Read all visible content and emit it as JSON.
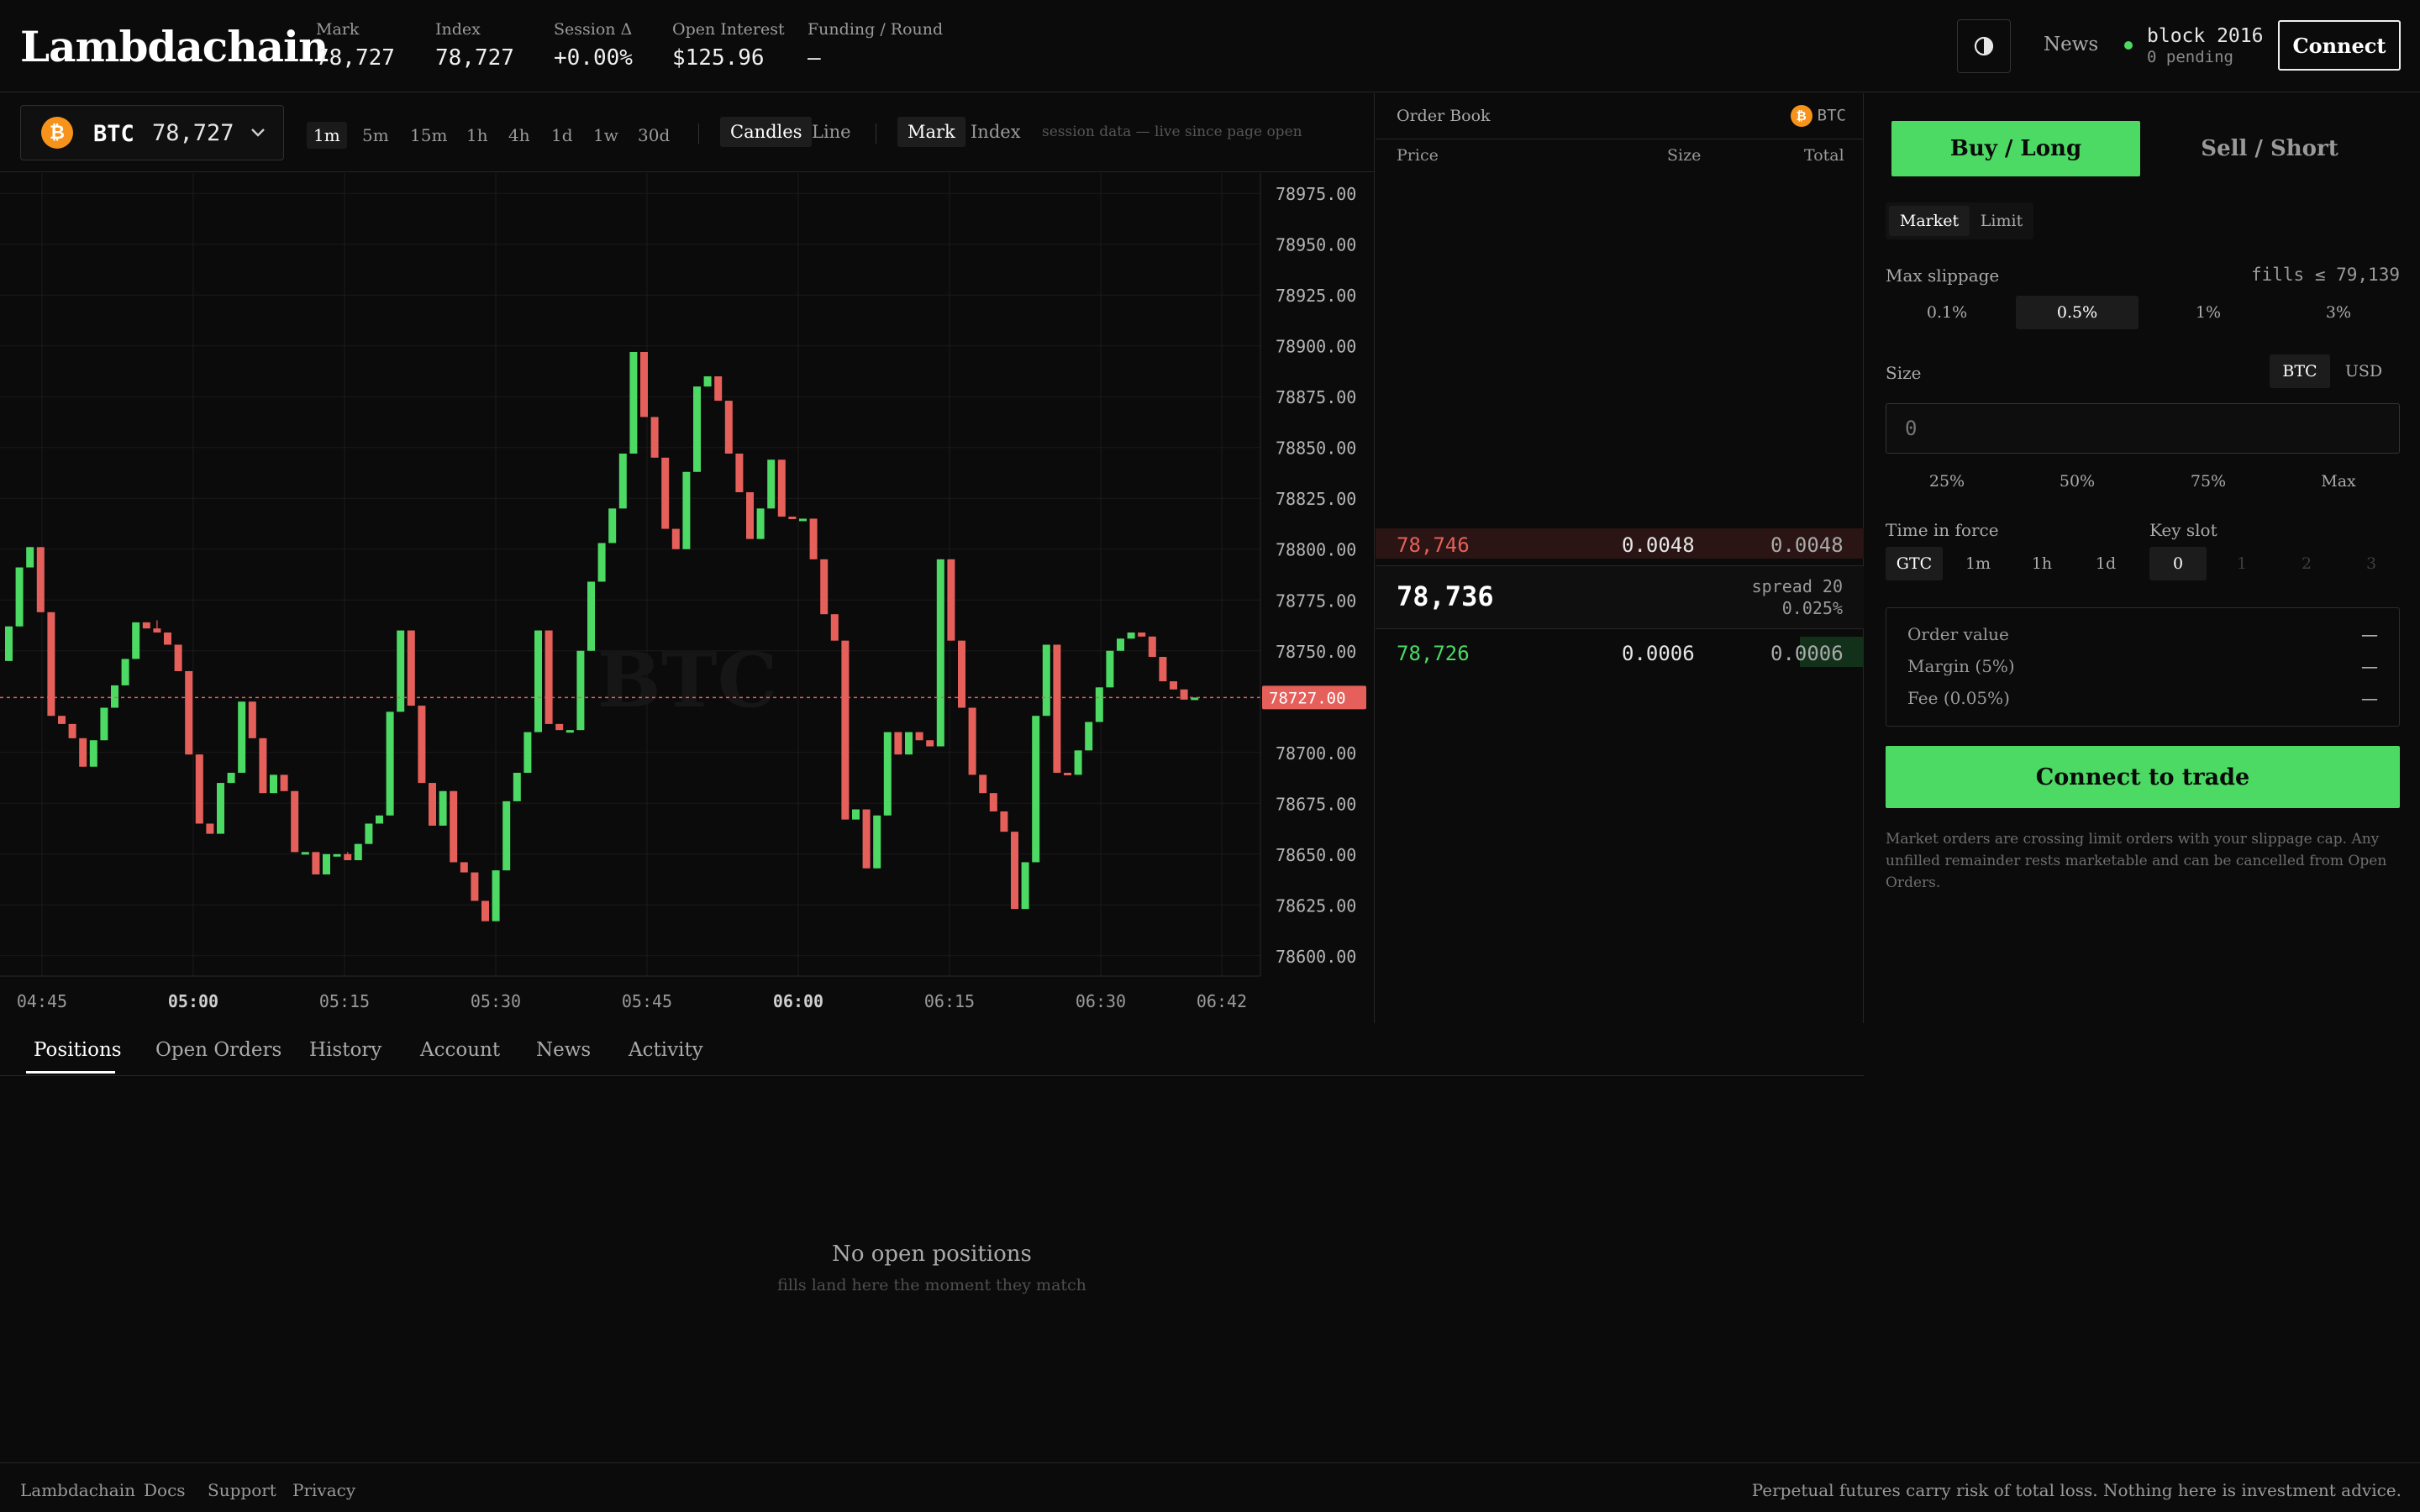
{
  "header": {
    "logo": "Lambdachain",
    "stats": [
      {
        "label": "Mark",
        "value": "78,727"
      },
      {
        "label": "Index",
        "value": "78,727"
      },
      {
        "label": "Session Δ",
        "value": "+0.00%"
      },
      {
        "label": "Open Interest",
        "value": "$125.96"
      },
      {
        "label": "Funding / Round",
        "value": "—"
      }
    ],
    "news_label": "News",
    "block_label": "block 2016",
    "pending_label": "0 pending",
    "connect_label": "Connect"
  },
  "toolbar": {
    "asset_symbol": "BTC",
    "asset_price": "78,727",
    "coin_glyph": "₿",
    "timeframes": [
      "1m",
      "5m",
      "15m",
      "1h",
      "4h",
      "1d",
      "1w",
      "30d"
    ],
    "active_timeframe": "1m",
    "chart_types": [
      "Candles",
      "Line"
    ],
    "active_chart_type": "Candles",
    "price_sources": [
      "Mark",
      "Index"
    ],
    "active_price_source": "Mark",
    "session_note": "session data — live since page open"
  },
  "chart_data": {
    "type": "candlestick",
    "watermark": "BTC",
    "ylim": [
      78590,
      78985
    ],
    "y_ticks": [
      "78975.00",
      "78950.00",
      "78925.00",
      "78900.00",
      "78875.00",
      "78850.00",
      "78825.00",
      "78800.00",
      "78775.00",
      "78750.00",
      "78700.00",
      "78675.00",
      "78650.00",
      "78625.00",
      "78600.00"
    ],
    "x_ticks": [
      "04:45",
      "05:00",
      "05:15",
      "05:30",
      "05:45",
      "06:00",
      "06:15",
      "06:30",
      "06:42"
    ],
    "current_price": 78727,
    "current_price_label": "78727.00",
    "candles": [
      [
        78745,
        78762,
        78745,
        78762
      ],
      [
        78762,
        78791,
        78762,
        78791
      ],
      [
        78791,
        78801,
        78791,
        78801
      ],
      [
        78801,
        78801,
        78769,
        78769
      ],
      [
        78769,
        78769,
        78718,
        78718
      ],
      [
        78718,
        78718,
        78714,
        78714
      ],
      [
        78714,
        78714,
        78707,
        78707
      ],
      [
        78707,
        78707,
        78693,
        78693
      ],
      [
        78693,
        78706,
        78693,
        78706
      ],
      [
        78706,
        78722,
        78706,
        78722
      ],
      [
        78722,
        78733,
        78722,
        78733
      ],
      [
        78733,
        78746,
        78733,
        78746
      ],
      [
        78746,
        78764,
        78746,
        78764
      ],
      [
        78764,
        78764,
        78761,
        78761
      ],
      [
        78761,
        78765,
        78759,
        78759
      ],
      [
        78759,
        78759,
        78753,
        78753
      ],
      [
        78753,
        78753,
        78740,
        78740
      ],
      [
        78740,
        78740,
        78699,
        78699
      ],
      [
        78699,
        78699,
        78665,
        78665
      ],
      [
        78665,
        78665,
        78660,
        78660
      ],
      [
        78660,
        78685,
        78660,
        78685
      ],
      [
        78685,
        78690,
        78685,
        78690
      ],
      [
        78690,
        78725,
        78690,
        78725
      ],
      [
        78725,
        78725,
        78707,
        78707
      ],
      [
        78707,
        78707,
        78680,
        78680
      ],
      [
        78680,
        78689,
        78680,
        78689
      ],
      [
        78689,
        78689,
        78681,
        78681
      ],
      [
        78681,
        78681,
        78651,
        78651
      ],
      [
        78651,
        78651,
        78651,
        78651
      ],
      [
        78651,
        78651,
        78640,
        78640
      ],
      [
        78640,
        78650,
        78640,
        78650
      ],
      [
        78650,
        78650,
        78650,
        78650
      ],
      [
        78650,
        78651,
        78647,
        78647
      ],
      [
        78647,
        78655,
        78647,
        78655
      ],
      [
        78655,
        78665,
        78655,
        78665
      ],
      [
        78665,
        78669,
        78665,
        78669
      ],
      [
        78669,
        78720,
        78669,
        78720
      ],
      [
        78720,
        78760,
        78720,
        78760
      ],
      [
        78760,
        78760,
        78723,
        78723
      ],
      [
        78723,
        78723,
        78685,
        78685
      ],
      [
        78685,
        78685,
        78664,
        78664
      ],
      [
        78664,
        78681,
        78664,
        78681
      ],
      [
        78681,
        78681,
        78646,
        78646
      ],
      [
        78646,
        78646,
        78641,
        78641
      ],
      [
        78641,
        78641,
        78627,
        78627
      ],
      [
        78627,
        78627,
        78617,
        78617
      ],
      [
        78617,
        78642,
        78617,
        78642
      ],
      [
        78642,
        78676,
        78642,
        78676
      ],
      [
        78676,
        78690,
        78676,
        78690
      ],
      [
        78690,
        78710,
        78690,
        78710
      ],
      [
        78710,
        78760,
        78710,
        78760
      ],
      [
        78760,
        78760,
        78714,
        78714
      ],
      [
        78714,
        78714,
        78711,
        78711
      ],
      [
        78711,
        78711,
        78711,
        78711
      ],
      [
        78711,
        78750,
        78711,
        78750
      ],
      [
        78750,
        78784,
        78750,
        78784
      ],
      [
        78784,
        78803,
        78784,
        78803
      ],
      [
        78803,
        78820,
        78803,
        78820
      ],
      [
        78820,
        78847,
        78820,
        78847
      ],
      [
        78847,
        78897,
        78847,
        78897
      ],
      [
        78897,
        78897,
        78865,
        78865
      ],
      [
        78865,
        78865,
        78845,
        78845
      ],
      [
        78845,
        78845,
        78810,
        78810
      ],
      [
        78810,
        78810,
        78800,
        78800
      ],
      [
        78800,
        78838,
        78800,
        78838
      ],
      [
        78838,
        78880,
        78838,
        78880
      ],
      [
        78880,
        78885,
        78880,
        78885
      ],
      [
        78885,
        78885,
        78873,
        78873
      ],
      [
        78873,
        78873,
        78847,
        78847
      ],
      [
        78847,
        78847,
        78828,
        78828
      ],
      [
        78828,
        78828,
        78805,
        78805
      ],
      [
        78805,
        78820,
        78805,
        78820
      ],
      [
        78820,
        78844,
        78820,
        78844
      ],
      [
        78844,
        78844,
        78816,
        78816
      ],
      [
        78816,
        78816,
        78815,
        78815
      ],
      [
        78815,
        78815,
        78815,
        78815
      ],
      [
        78815,
        78815,
        78795,
        78795
      ],
      [
        78795,
        78795,
        78768,
        78768
      ],
      [
        78768,
        78768,
        78755,
        78755
      ],
      [
        78755,
        78755,
        78667,
        78667
      ],
      [
        78667,
        78667,
        78672,
        78672
      ],
      [
        78672,
        78672,
        78643,
        78643
      ],
      [
        78643,
        78669,
        78643,
        78669
      ],
      [
        78669,
        78710,
        78669,
        78710
      ],
      [
        78710,
        78710,
        78699,
        78699
      ],
      [
        78699,
        78710,
        78699,
        78710
      ],
      [
        78710,
        78710,
        78706,
        78706
      ],
      [
        78706,
        78706,
        78703,
        78703
      ],
      [
        78703,
        78795,
        78703,
        78795
      ],
      [
        78795,
        78795,
        78755,
        78755
      ],
      [
        78755,
        78755,
        78722,
        78722
      ],
      [
        78722,
        78722,
        78689,
        78689
      ],
      [
        78689,
        78689,
        78680,
        78680
      ],
      [
        78680,
        78680,
        78671,
        78671
      ],
      [
        78671,
        78671,
        78661,
        78661
      ],
      [
        78661,
        78661,
        78623,
        78623
      ],
      [
        78623,
        78646,
        78623,
        78646
      ],
      [
        78646,
        78718,
        78646,
        78718
      ],
      [
        78718,
        78753,
        78718,
        78753
      ],
      [
        78753,
        78753,
        78690,
        78690
      ],
      [
        78690,
        78690,
        78689,
        78689
      ],
      [
        78689,
        78701,
        78689,
        78701
      ],
      [
        78701,
        78715,
        78701,
        78715
      ],
      [
        78715,
        78732,
        78715,
        78732
      ],
      [
        78732,
        78750,
        78732,
        78750
      ],
      [
        78750,
        78756,
        78750,
        78756
      ],
      [
        78756,
        78759,
        78756,
        78759
      ],
      [
        78759,
        78759,
        78757,
        78757
      ],
      [
        78757,
        78757,
        78747,
        78747
      ],
      [
        78747,
        78747,
        78735,
        78735
      ],
      [
        78735,
        78735,
        78731,
        78731
      ],
      [
        78731,
        78731,
        78726,
        78726
      ],
      [
        78726,
        78726,
        78727,
        78727
      ]
    ]
  },
  "orderbook": {
    "title": "Order Book",
    "asset": "BTC",
    "columns": [
      "Price",
      "Size",
      "Total"
    ],
    "asks": [
      {
        "price": "78,746",
        "size": "0.0048",
        "total": "0.0048"
      }
    ],
    "mid_price": "78,736",
    "spread_label": "spread 20",
    "spread_pct": "0.025%",
    "bids": [
      {
        "price": "78,726",
        "size": "0.0006",
        "total": "0.0006"
      }
    ]
  },
  "trade": {
    "buy_label": "Buy / Long",
    "sell_label": "Sell / Short",
    "order_types": [
      "Market",
      "Limit"
    ],
    "max_slippage_label": "Max slippage",
    "fills_label": "fills ≤ 79,139",
    "slippage_options": [
      "0.1%",
      "0.5%",
      "1%",
      "3%"
    ],
    "size_label": "Size",
    "size_units": [
      "BTC",
      "USD"
    ],
    "size_placeholder": "0",
    "size_pcts": [
      "25%",
      "50%",
      "75%",
      "Max"
    ],
    "tif_label": "Time in force",
    "tif_options": [
      "GTC",
      "1m",
      "1h",
      "1d"
    ],
    "key_slot_label": "Key slot",
    "key_slots": [
      "0",
      "1",
      "2",
      "3"
    ],
    "summary": [
      {
        "label": "Order value",
        "value": "—"
      },
      {
        "label": "Margin (5%)",
        "value": "—"
      },
      {
        "label": "Fee (0.05%)",
        "value": "—"
      }
    ],
    "action_label": "Connect to trade",
    "note": "Market orders are crossing limit orders with your slippage cap. Any unfilled remainder rests marketable and can be cancelled from Open Orders."
  },
  "bottom": {
    "tabs": [
      "Positions",
      "Open Orders",
      "History",
      "Account",
      "News",
      "Activity"
    ],
    "empty_title": "No open positions",
    "empty_sub": "fills land here the moment they match"
  },
  "footer": {
    "links": [
      "Lambdachain",
      "Docs",
      "Support",
      "Privacy"
    ],
    "disclaimer": "Perpetual futures carry risk of total loss. Nothing here is investment advice."
  },
  "colors": {
    "up": "#4cd964",
    "down": "#e5605a",
    "background": "#0b0b0b",
    "accent_btc": "#f7931a"
  }
}
